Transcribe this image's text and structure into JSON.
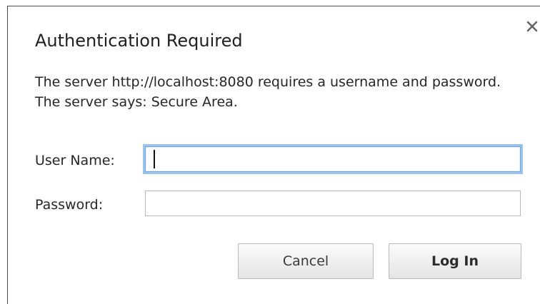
{
  "dialog": {
    "title": "Authentication Required",
    "message": "The server http://localhost:8080 requires a username and password. The server says: Secure Area.",
    "close_icon": "close-icon"
  },
  "form": {
    "username_label": "User Name:",
    "username_value": "",
    "password_label": "Password:",
    "password_value": ""
  },
  "buttons": {
    "cancel_label": "Cancel",
    "login_label": "Log In"
  },
  "colors": {
    "focus_ring": "#9cc3e8",
    "border": "#b8b8b8"
  }
}
